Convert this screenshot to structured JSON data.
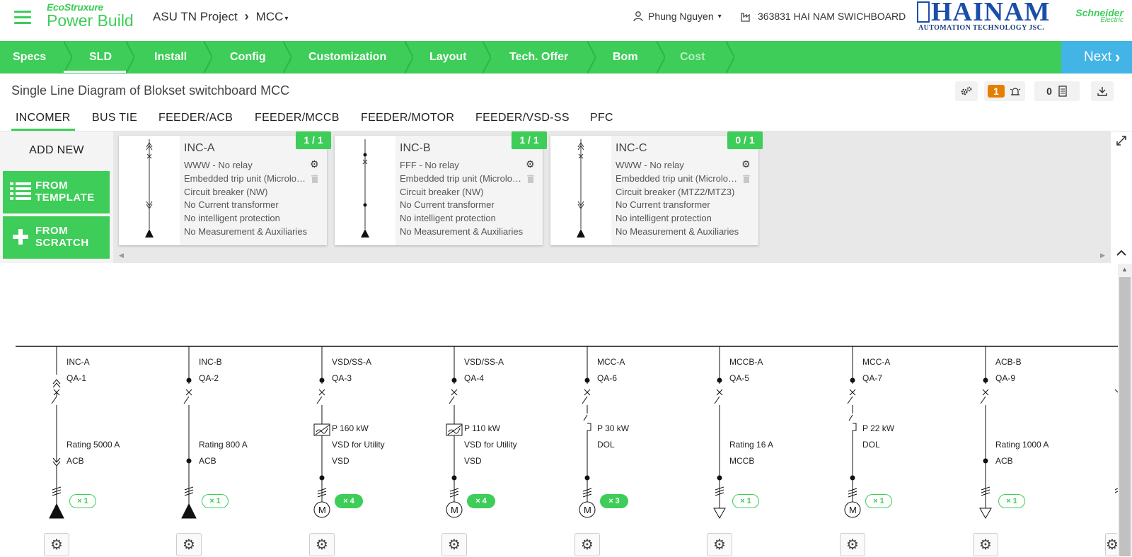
{
  "brand": {
    "top": "EcoStruxure",
    "bottom": "Power Build"
  },
  "project": {
    "name": "ASU TN Project",
    "chevron": "›",
    "switchboard_short": "MCC",
    "caret": "▾"
  },
  "user": {
    "name": "Phung Nguyen",
    "caret": "▾"
  },
  "switchboard": {
    "id_name": "363831 HAI NAM SWICHBOARD"
  },
  "logos": {
    "hainam_big": "HAINAM",
    "hainam_small": "AUTOMATION TECHNOLOGY JSC.",
    "schneider_1": "Schneider",
    "schneider_2": "Electric"
  },
  "steps": [
    "Specs",
    "SLD",
    "Install",
    "Config",
    "Customization",
    "Layout",
    "Tech. Offer",
    "Bom",
    "Cost"
  ],
  "next_label": "Next",
  "page_title": "Single Line Diagram of  Blokset switchboard MCC",
  "toolbar": {
    "alerts_count": "1",
    "notes_count": "0"
  },
  "subtabs": [
    "INCOMER",
    "BUS TIE",
    "FEEDER/ACB",
    "FEEDER/MCCB",
    "FEEDER/MOTOR",
    "FEEDER/VSD-SS",
    "PFC"
  ],
  "add_new": {
    "label": "ADD NEW",
    "from_template": [
      "FROM",
      "TEMPLATE"
    ],
    "from_scratch": [
      "FROM",
      "SCRATCH"
    ]
  },
  "cards": [
    {
      "name": "INC-A",
      "count": "1 / 1",
      "lines": [
        "WWW - No relay",
        "Embedded trip unit (Micrologic)",
        "Circuit breaker (NW)",
        "No Current transformer",
        "No intelligent protection",
        "No Measurement & Auxiliaries"
      ]
    },
    {
      "name": "INC-B",
      "count": "1 / 1",
      "lines": [
        "FFF - No relay",
        "Embedded trip unit (Micrologic)",
        "Circuit breaker (NW)",
        "No Current transformer",
        "No intelligent protection",
        "No Measurement & Auxiliaries"
      ]
    },
    {
      "name": "INC-C",
      "count": "0 / 1",
      "lines": [
        "WWW - No relay",
        "Embedded trip unit (Micrologic)",
        "Circuit breaker (MTZ2/MTZ3)",
        "No Current transformer",
        "No intelligent protection",
        "No Measurement & Auxiliaries"
      ]
    }
  ],
  "feeders": [
    {
      "name": "INC-A",
      "code": "QA-1",
      "lines": [
        "Rating 5000 A",
        "ACB"
      ],
      "mult": "× 1",
      "mult_style": "outline"
    },
    {
      "name": "INC-B",
      "code": "QA-2",
      "lines": [
        "Rating 800 A",
        "ACB"
      ],
      "mult": "× 1",
      "mult_style": "outline"
    },
    {
      "name": "VSD/SS-A",
      "code": "QA-3",
      "lines": [
        "P 160 kW",
        "VSD for Utility",
        "VSD"
      ],
      "mult": "× 4",
      "mult_style": "filled"
    },
    {
      "name": "VSD/SS-A",
      "code": "QA-4",
      "lines": [
        "P 110 kW",
        "VSD for Utility",
        "VSD"
      ],
      "mult": "× 4",
      "mult_style": "filled"
    },
    {
      "name": "MCC-A",
      "code": "QA-6",
      "lines": [
        "P 30 kW",
        "DOL"
      ],
      "mult": "× 3",
      "mult_style": "filled"
    },
    {
      "name": "MCCB-A",
      "code": "QA-5",
      "lines": [
        "Rating 16 A",
        "MCCB"
      ],
      "mult": "× 1",
      "mult_style": "outline"
    },
    {
      "name": "MCC-A",
      "code": "QA-7",
      "lines": [
        "P 22 kW",
        "DOL"
      ],
      "mult": "× 1",
      "mult_style": "outline"
    },
    {
      "name": "ACB-B",
      "code": "QA-9",
      "lines": [
        "Rating 1000 A",
        "ACB"
      ],
      "mult": "× 1",
      "mult_style": "outline"
    }
  ],
  "icons": {
    "gear": "⚙",
    "trash": "🗑",
    "expand": "⤢",
    "collapse": "︿",
    "motor": "M"
  }
}
